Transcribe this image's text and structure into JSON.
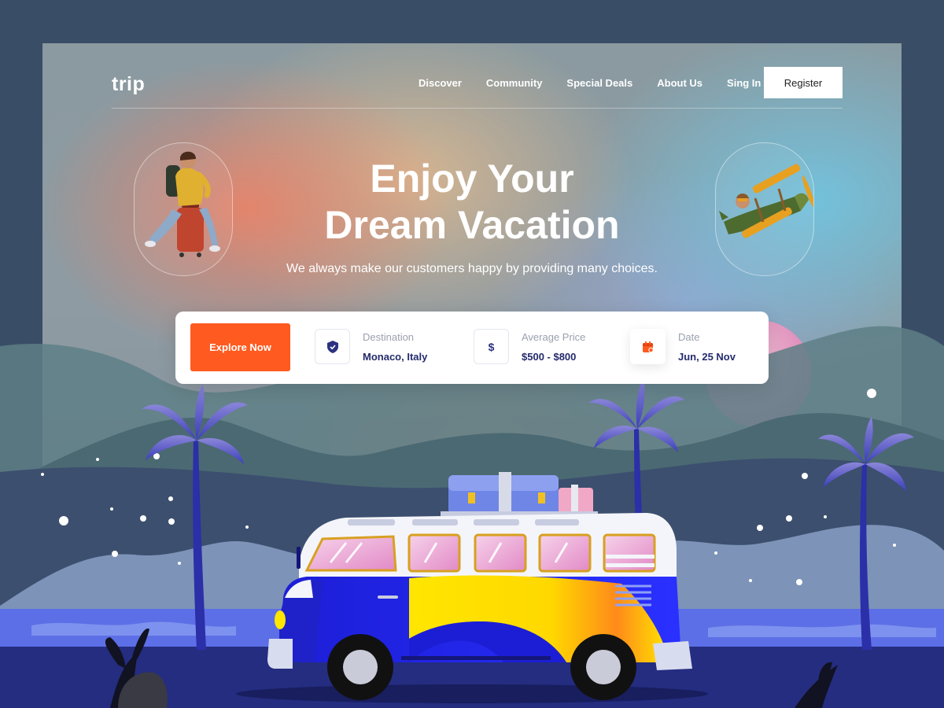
{
  "brand": {
    "logo": "trip"
  },
  "nav": {
    "items": [
      "Discover",
      "Community",
      "Special Deals",
      "About Us",
      "Sing In"
    ],
    "register_label": "Register"
  },
  "hero": {
    "title_line1": "Enjoy Your",
    "title_line2": "Dream Vacation",
    "subtitle": "We always make our customers happy by providing many choices."
  },
  "search": {
    "explore_label": "Explore Now",
    "fields": [
      {
        "label": "Destination",
        "value": "Monaco, Italy",
        "icon": "shield-check-icon"
      },
      {
        "label": "Average Price",
        "value": "$500 - $800",
        "icon": "dollar-icon"
      },
      {
        "label": "Date",
        "value": "Jun, 25 Nov",
        "icon": "calendar-icon"
      }
    ]
  },
  "illustration": {
    "left_pill": "traveler-on-suitcase",
    "right_pill": "cartoon-biplane",
    "scene": "van-with-luggage-palm-trees-beach-night"
  },
  "colors": {
    "accent": "#ff5a1f",
    "navy_text": "#242b6b",
    "background": "#3a4d66",
    "van_blue": "#1c1ed6",
    "van_yellow": "#ffe600"
  }
}
